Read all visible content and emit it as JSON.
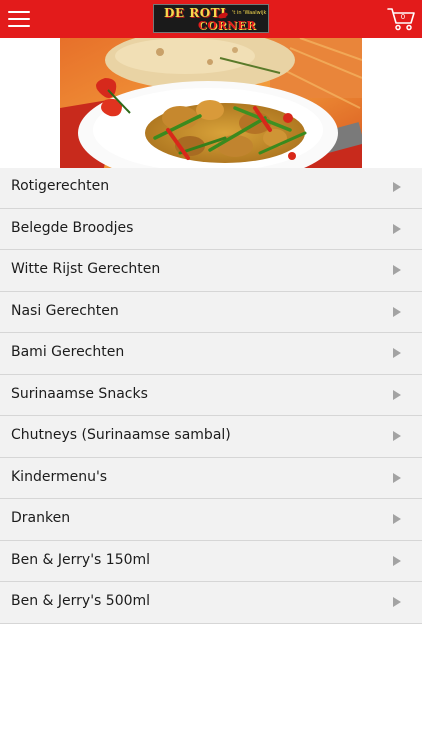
{
  "header": {
    "logo_line1": "DE ROTI",
    "logo_line2": "CORNER",
    "logo_tagline": "'t in 'Waalwijk",
    "cart_count": "0",
    "background_color": "#e31b1b"
  },
  "icons": {
    "menu": "hamburger-menu-icon",
    "cart": "shopping-cart-icon",
    "row_arrow": "chevron-right-icon"
  },
  "categories": [
    {
      "label": "Rotigerechten"
    },
    {
      "label": "Belegde Broodjes"
    },
    {
      "label": "Witte Rijst Gerechten"
    },
    {
      "label": "Nasi Gerechten"
    },
    {
      "label": "Bami Gerechten"
    },
    {
      "label": "Surinaamse Snacks"
    },
    {
      "label": "Chutneys (Surinaamse sambal)"
    },
    {
      "label": "Kindermenu's"
    },
    {
      "label": "Dranken"
    },
    {
      "label": "Ben & Jerry's 150ml"
    },
    {
      "label": "Ben & Jerry's 500ml"
    }
  ]
}
